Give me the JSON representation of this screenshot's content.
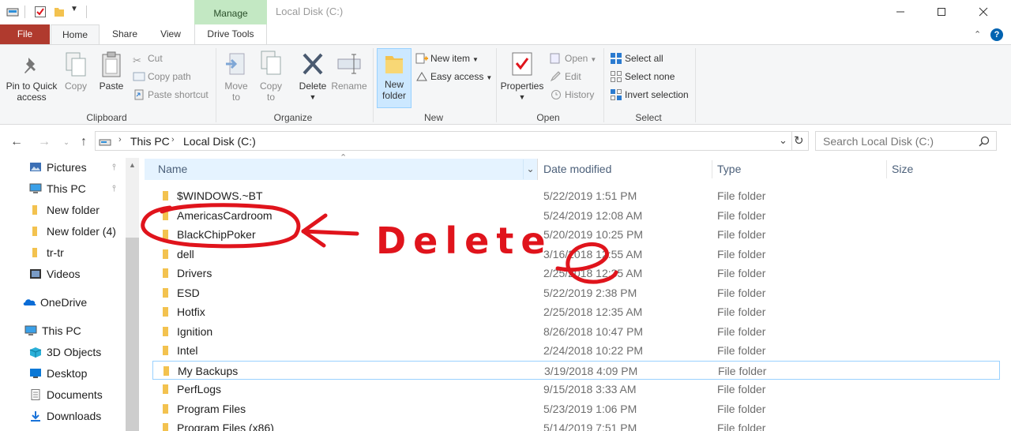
{
  "window": {
    "title": "Local Disk (C:)",
    "context_tab": "Manage"
  },
  "tabs": {
    "file": "File",
    "home": "Home",
    "share": "Share",
    "view": "View",
    "drive_tools": "Drive Tools"
  },
  "ribbon": {
    "clipboard": {
      "label": "Clipboard",
      "pin_line1": "Pin to Quick",
      "pin_line2": "access",
      "copy": "Copy",
      "paste": "Paste",
      "cut": "Cut",
      "copy_path": "Copy path",
      "paste_shortcut": "Paste shortcut"
    },
    "organize": {
      "label": "Organize",
      "move_line1": "Move",
      "move_line2": "to",
      "copy_line1": "Copy",
      "copy_line2": "to",
      "delete": "Delete",
      "rename": "Rename"
    },
    "new": {
      "label": "New",
      "folder_line1": "New",
      "folder_line2": "folder",
      "new_item": "New item",
      "easy_access": "Easy access"
    },
    "open": {
      "label": "Open",
      "properties": "Properties",
      "open": "Open",
      "edit": "Edit",
      "history": "History"
    },
    "select": {
      "label": "Select",
      "select_all": "Select all",
      "select_none": "Select none",
      "invert": "Invert selection"
    }
  },
  "address": {
    "crumbs": [
      "This PC",
      "Local Disk (C:)"
    ],
    "search_placeholder": "Search Local Disk (C:)"
  },
  "nav": [
    {
      "label": "Pictures",
      "icon": "pictures-icon",
      "pinned": true
    },
    {
      "label": "This PC",
      "icon": "computer-icon",
      "pinned": true
    },
    {
      "label": "New folder",
      "icon": "folder-icon",
      "pinned": false
    },
    {
      "label": "New folder (4)",
      "icon": "folder-icon",
      "pinned": false
    },
    {
      "label": "tr-tr",
      "icon": "folder-icon",
      "pinned": false
    },
    {
      "label": "Videos",
      "icon": "videos-icon",
      "pinned": false
    },
    {
      "label": "OneDrive",
      "icon": "onedrive-icon",
      "pinned": false
    },
    {
      "label": "This PC",
      "icon": "computer-icon",
      "pinned": false
    },
    {
      "label": "3D Objects",
      "icon": "3d-objects-icon",
      "pinned": false
    },
    {
      "label": "Desktop",
      "icon": "desktop-icon",
      "pinned": false
    },
    {
      "label": "Documents",
      "icon": "documents-icon",
      "pinned": false
    },
    {
      "label": "Downloads",
      "icon": "downloads-icon",
      "pinned": false
    }
  ],
  "columns": {
    "name": "Name",
    "date": "Date modified",
    "type": "Type",
    "size": "Size"
  },
  "files": [
    {
      "name": "$WINDOWS.~BT",
      "date": "5/22/2019 1:51 PM",
      "type": "File folder"
    },
    {
      "name": "AmericasCardroom",
      "date": "5/24/2019 12:08 AM",
      "type": "File folder"
    },
    {
      "name": "BlackChipPoker",
      "date": "5/20/2019 10:25 PM",
      "type": "File folder"
    },
    {
      "name": "dell",
      "date": "3/16/2018 12:55 AM",
      "type": "File folder"
    },
    {
      "name": "Drivers",
      "date": "2/25/2018 12:35 AM",
      "type": "File folder"
    },
    {
      "name": "ESD",
      "date": "5/22/2019 2:38 PM",
      "type": "File folder"
    },
    {
      "name": "Hotfix",
      "date": "2/25/2018 12:35 AM",
      "type": "File folder"
    },
    {
      "name": "Ignition",
      "date": "8/26/2018 10:47 PM",
      "type": "File folder"
    },
    {
      "name": "Intel",
      "date": "2/24/2018 10:22 PM",
      "type": "File folder"
    },
    {
      "name": "My Backups",
      "date": "3/19/2018 4:09 PM",
      "type": "File folder",
      "selected": true
    },
    {
      "name": "PerfLogs",
      "date": "9/15/2018 3:33 AM",
      "type": "File folder"
    },
    {
      "name": "Program Files",
      "date": "5/23/2019 1:06 PM",
      "type": "File folder"
    },
    {
      "name": "Program Files (x86)",
      "date": "5/14/2019 7:51 PM",
      "type": "File folder"
    }
  ],
  "annotation": {
    "text": "Delete",
    "color": "#e0141c"
  },
  "colors": {
    "file_tab": "#b03a2e",
    "manage_tab": "#c3e8c3",
    "folder": "#f3c24f",
    "accent": "#0063b1"
  }
}
